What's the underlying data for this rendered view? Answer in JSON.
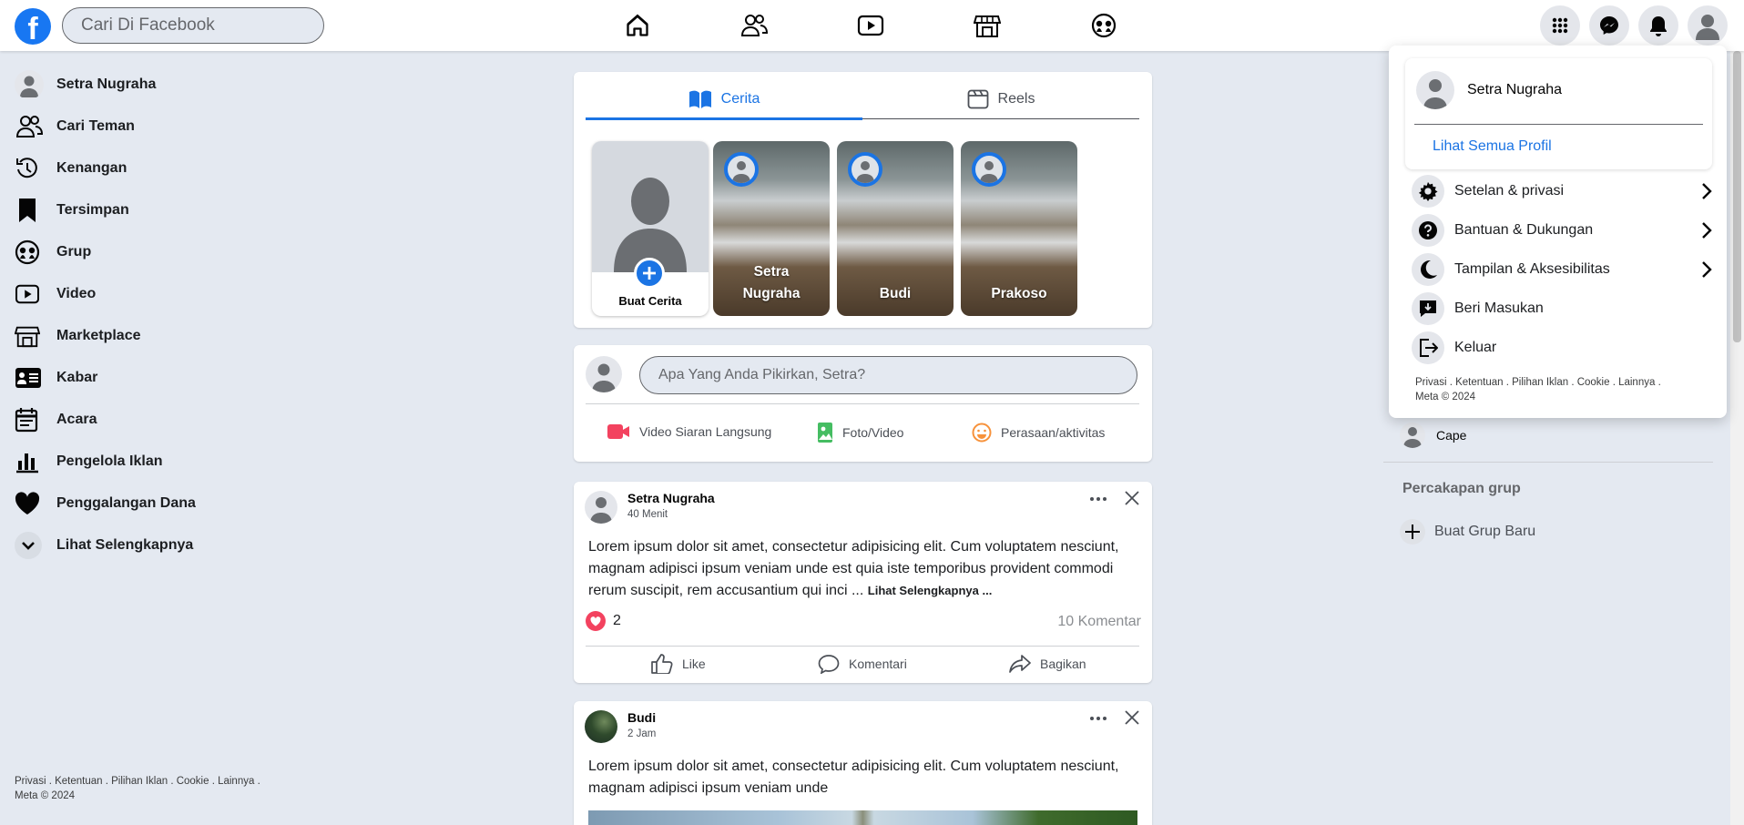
{
  "header": {
    "logo_letter": "f",
    "search_placeholder": "Cari Di Facebook",
    "nav_icons": [
      "home-icon",
      "friends-icon",
      "video-icon",
      "marketplace-icon",
      "groups-icon"
    ],
    "right_icons": [
      "grid-menu-icon",
      "messenger-icon",
      "bell-icon",
      "profile-avatar-icon"
    ]
  },
  "sidebar": {
    "items": [
      {
        "label": "Setra Nugraha",
        "icon": "avatar-icon"
      },
      {
        "label": "Cari Teman",
        "icon": "friends-icon"
      },
      {
        "label": "Kenangan",
        "icon": "memories-icon"
      },
      {
        "label": "Tersimpan",
        "icon": "bookmark-icon"
      },
      {
        "label": "Grup",
        "icon": "groups-icon"
      },
      {
        "label": "Video",
        "icon": "video-icon"
      },
      {
        "label": "Marketplace",
        "icon": "marketplace-icon"
      },
      {
        "label": "Kabar",
        "icon": "news-icon"
      },
      {
        "label": "Acara",
        "icon": "calendar-icon"
      },
      {
        "label": "Pengelola Iklan",
        "icon": "chart-icon"
      },
      {
        "label": "Penggalangan Dana",
        "icon": "heart-icon"
      },
      {
        "label": "Lihat Selengkapnya",
        "icon": "chevron-down-icon"
      }
    ],
    "footer_line1": "Privasi . Ketentuan . Pilihan Iklan . Cookie . Lainnya .",
    "footer_line2": "Meta © 2024"
  },
  "stories": {
    "tab_stories": "Cerita",
    "tab_reels": "Reels",
    "create_label": "Buat Cerita",
    "items": [
      {
        "name": "Setra Nugraha"
      },
      {
        "name": "Budi"
      },
      {
        "name": "Prakoso"
      }
    ]
  },
  "composer": {
    "placeholder": "Apa Yang Anda Pikirkan, Setra?",
    "live_label": "Video Siaran Langsung",
    "photo_label": "Foto/Video",
    "feeling_label": "Perasaan/aktivitas"
  },
  "posts": [
    {
      "author": "Setra Nugraha",
      "time": "40 Menit",
      "text": "Lorem ipsum dolor sit amet, consectetur adipisicing elit. Cum voluptatem nesciunt, magnam adipisci ipsum veniam unde est quia iste temporibus provident commodi rerum suscipit, rem accusantium qui inci ... ",
      "more": "Lihat Selengkapnya ...",
      "likes": "2",
      "comments": "10 Komentar",
      "like_label": "Like",
      "comment_label": "Komentari",
      "share_label": "Bagikan"
    },
    {
      "author": "Budi",
      "time": "2 Jam",
      "text": "Lorem ipsum dolor sit amet, consectetur adipisicing elit. Cum voluptatem nesciunt, magnam adipisci ipsum veniam unde"
    }
  ],
  "right": {
    "contact_name": "Cape",
    "group_heading": "Percakapan grup",
    "new_group": "Buat Grup Baru"
  },
  "menu": {
    "profile_name": "Setra Nugraha",
    "see_all": "Lihat Semua Profil",
    "items": [
      {
        "label": "Setelan & privasi",
        "icon": "gear-icon",
        "has_arrow": true
      },
      {
        "label": "Bantuan & Dukungan",
        "icon": "help-icon",
        "has_arrow": true
      },
      {
        "label": "Tampilan & Aksesibilitas",
        "icon": "moon-icon",
        "has_arrow": true
      },
      {
        "label": "Beri Masukan",
        "icon": "feedback-icon",
        "has_arrow": false
      },
      {
        "label": "Keluar",
        "icon": "logout-icon",
        "has_arrow": false
      }
    ],
    "footer_line1": "Privasi . Ketentuan . Pilihan Iklan . Cookie . Lainnya .",
    "footer_line2": "Meta © 2024"
  },
  "colors": {
    "brand": "#1877f2",
    "background": "#e4e9f1",
    "link": "#1b74e4"
  }
}
